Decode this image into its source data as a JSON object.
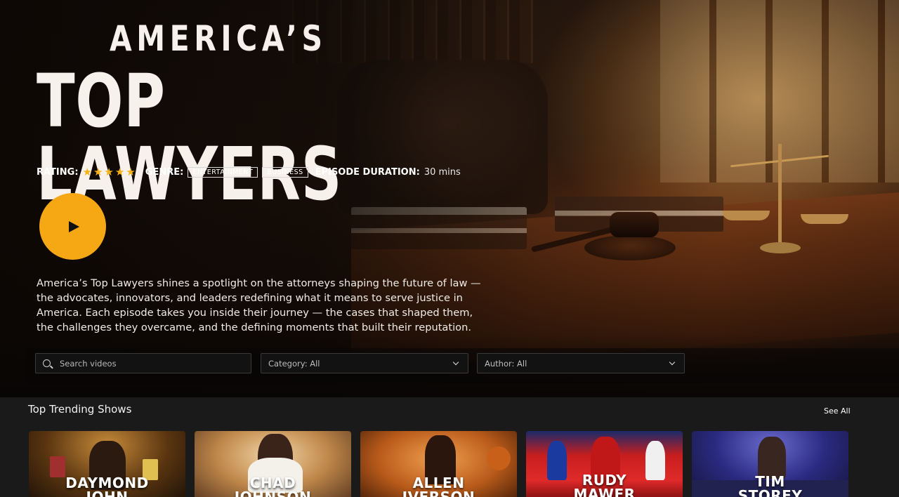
{
  "hero": {
    "title_top": "AMERICA’S",
    "title_main": "TOP LAWYERS",
    "rating_label": "RATING:",
    "rating": 5,
    "rating_stars": [
      "★",
      "★",
      "★",
      "★",
      "★"
    ],
    "genre_label": "GENRE:",
    "genres": [
      "ENTERTAINMENT",
      "BUSINESS"
    ],
    "duration_label": "EPISODE DURATION:",
    "duration_value": "30 mins",
    "description": "America’s Top Lawyers shines a spotlight on the attorneys shaping the future of law — the advocates, innovators, and leaders redefining what it means to serve justice in America. Each episode takes you inside their journey — the cases that shaped them, the challenges they overcame, and the defining moments that built their reputation.",
    "accent_color": "#f6a814",
    "star_color": "#f5b216",
    "play_icon": "play-icon"
  },
  "filters": {
    "search_placeholder": "Search videos",
    "search_icon": "search-icon",
    "category": "Category: All",
    "author": "Author: All",
    "dropdown_icon": "chevron-down-icon"
  },
  "trending": {
    "title": "Top Trending Shows",
    "see_all": "See All",
    "shows": [
      {
        "line1": "DAYMOND",
        "line2": "JOHN"
      },
      {
        "line1": "CHAD",
        "line2": "JOHNSON"
      },
      {
        "line1": "ALLEN",
        "line2": "IVERSON"
      },
      {
        "line1": "RUDY",
        "line2": "MAWER"
      },
      {
        "line1": "TIM",
        "line2": "STOREY"
      }
    ]
  }
}
